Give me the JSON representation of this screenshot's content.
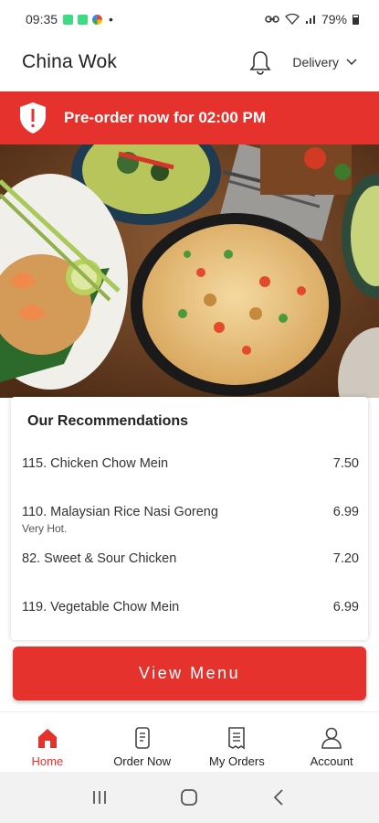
{
  "status_bar": {
    "time": "09:35",
    "dot": "•",
    "battery": "79%"
  },
  "header": {
    "title": "China Wok",
    "delivery_label": "Delivery"
  },
  "banner": {
    "text": "Pre-order now for 02:00 PM"
  },
  "recommendations": {
    "title": "Our Recommendations",
    "items": [
      {
        "name": "115. Chicken Chow Mein",
        "price": "7.50",
        "note": ""
      },
      {
        "name": "110. Malaysian Rice Nasi Goreng",
        "price": "6.99",
        "note": "Very Hot."
      },
      {
        "name": "82. Sweet & Sour Chicken",
        "price": "7.20",
        "note": ""
      },
      {
        "name": "119. Vegetable Chow Mein",
        "price": "6.99",
        "note": ""
      }
    ]
  },
  "view_menu": {
    "label": "View Menu"
  },
  "bottom_nav": {
    "items": [
      {
        "label": "Home",
        "icon": "home-icon",
        "active": true
      },
      {
        "label": "Order Now",
        "icon": "order-icon",
        "active": false
      },
      {
        "label": "My Orders",
        "icon": "receipt-icon",
        "active": false
      },
      {
        "label": "Account",
        "icon": "account-icon",
        "active": false
      }
    ]
  },
  "colors": {
    "accent": "#e5322d"
  }
}
